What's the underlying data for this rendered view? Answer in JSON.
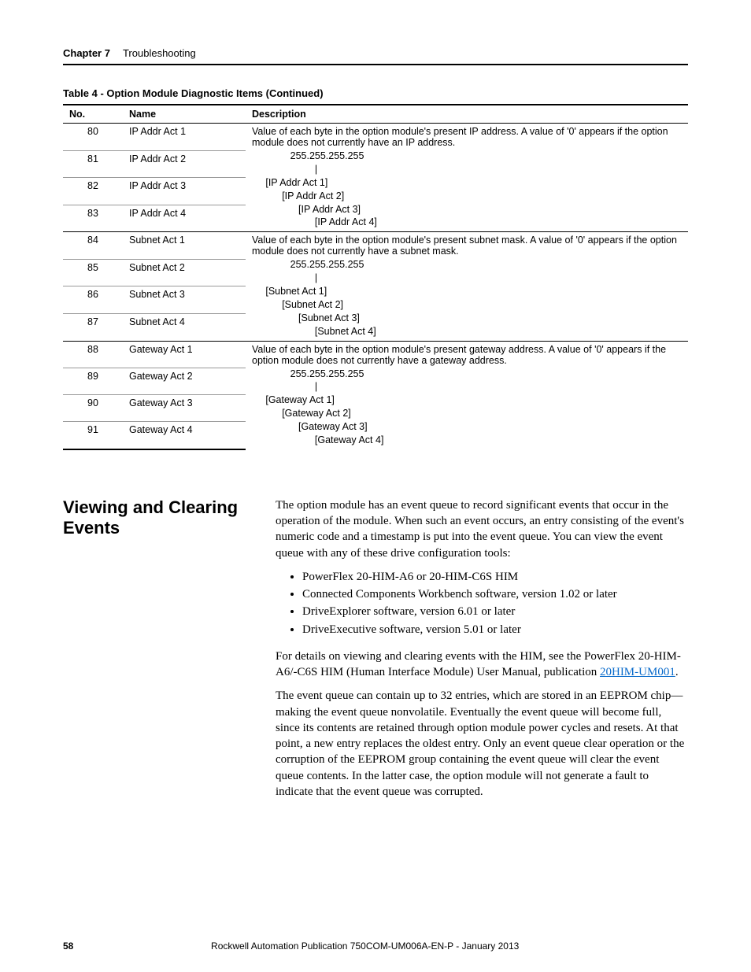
{
  "header": {
    "chapter": "Chapter 7",
    "title": "Troubleshooting"
  },
  "table": {
    "caption": "Table 4 - Option Module Diagnostic Items (Continued)",
    "headers": {
      "no": "No.",
      "name": "Name",
      "desc": "Description"
    },
    "groups": [
      {
        "rows": [
          {
            "no": "80",
            "name": "IP Addr Act 1"
          },
          {
            "no": "81",
            "name": "IP Addr Act 2"
          },
          {
            "no": "82",
            "name": "IP Addr Act 3"
          },
          {
            "no": "83",
            "name": "IP Addr Act 4"
          }
        ],
        "desc_lead": "Value of each byte in the option module's present IP address. A value of '0' appears if the option module does not currently have an IP address.",
        "desc_block": "              255.255.255.255\n                       |\n     [IP Addr Act 1]\n           [IP Addr Act 2]\n                 [IP Addr Act 3]\n                       [IP Addr Act 4]"
      },
      {
        "rows": [
          {
            "no": "84",
            "name": "Subnet Act 1"
          },
          {
            "no": "85",
            "name": "Subnet Act 2"
          },
          {
            "no": "86",
            "name": "Subnet Act 3"
          },
          {
            "no": "87",
            "name": "Subnet Act 4"
          }
        ],
        "desc_lead": "Value of each byte in the option module's present subnet mask. A value of '0' appears if the option module does not currently have a subnet mask.",
        "desc_block": "              255.255.255.255\n                       |\n     [Subnet Act 1]\n           [Subnet Act 2]\n                 [Subnet Act 3]\n                       [Subnet Act 4]"
      },
      {
        "rows": [
          {
            "no": "88",
            "name": "Gateway Act 1"
          },
          {
            "no": "89",
            "name": "Gateway Act 2"
          },
          {
            "no": "90",
            "name": "Gateway Act 3"
          },
          {
            "no": "91",
            "name": "Gateway Act 4"
          }
        ],
        "desc_lead": "Value of each byte in the option module's present gateway address. A value of '0' appears if the option module does not currently have a gateway address.",
        "desc_block": "              255.255.255.255\n                       |\n     [Gateway Act 1]\n           [Gateway Act 2]\n                 [Gateway Act 3]\n                       [Gateway Act 4]"
      }
    ]
  },
  "section": {
    "heading": "Viewing and Clearing Events",
    "para1": "The option module has an event queue to record significant events that occur in the operation of the module. When such an event occurs, an entry consisting of the event's numeric code and a timestamp is put into the event queue. You can view the event queue with any of these drive configuration tools:",
    "bullets": [
      "PowerFlex 20-HIM-A6 or 20-HIM-C6S HIM",
      "Connected Components Workbench software, version 1.02 or later",
      "DriveExplorer software, version 6.01 or later",
      "DriveExecutive software, version 5.01 or later"
    ],
    "para2_pre": "For details on viewing and clearing events with the HIM, see the PowerFlex 20-HIM-A6/-C6S HIM (Human Interface Module) User Manual, publication ",
    "para2_link": "20HIM-UM001",
    "para2_post": ".",
    "para3": "The event queue can contain up to 32 entries, which are stored in an EEPROM chip—making the event queue nonvolatile. Eventually the event queue will become full, since its contents are retained through option module power cycles and resets. At that point, a new entry replaces the oldest entry. Only an event queue clear operation or the corruption of the EEPROM group containing the event queue will clear the event queue contents. In the latter case, the option module will not generate a fault to indicate that the event queue was corrupted."
  },
  "footer": {
    "page": "58",
    "pub": "Rockwell Automation Publication 750COM-UM006A-EN-P - January 2013"
  }
}
